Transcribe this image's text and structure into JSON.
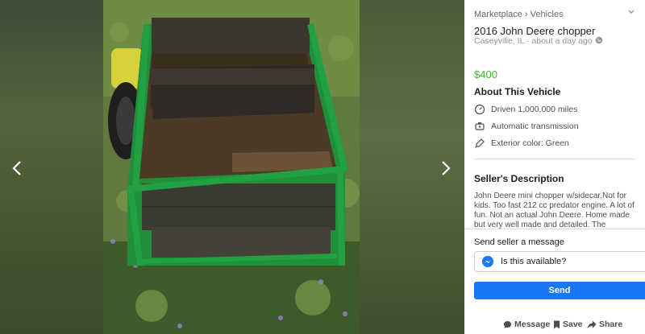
{
  "breadcrumb": {
    "root": "Marketplace",
    "separator": "›",
    "category": "Vehicles"
  },
  "listing": {
    "title": "2016 John Deere chopper",
    "location": "Caseyville, IL",
    "dot": "·",
    "posted": "about a day ago",
    "price": "$400"
  },
  "about": {
    "heading": "About This Vehicle",
    "items": [
      {
        "icon": "speedometer-icon",
        "text": "Driven 1,000,000 miles"
      },
      {
        "icon": "transmission-icon",
        "text": "Automatic transmission"
      },
      {
        "icon": "paint-brush-icon",
        "text": "Exterior color: Green"
      }
    ]
  },
  "description": {
    "heading": "Seller's Description",
    "text": "John Deere mini chopper w/sidecar.Not for kids. Too fast 212 cc predator engine. A lot of fun. Not an actual John Deere. Home made but very well made and detailed. The"
  },
  "message": {
    "heading": "Send seller a message",
    "value": "Is this available?",
    "send_label": "Send"
  },
  "actions": {
    "message": "Message",
    "save": "Save",
    "share": "Share"
  },
  "colors": {
    "price": "#42b72a",
    "send_button": "#1877f2",
    "messenger": "#1877f2"
  }
}
